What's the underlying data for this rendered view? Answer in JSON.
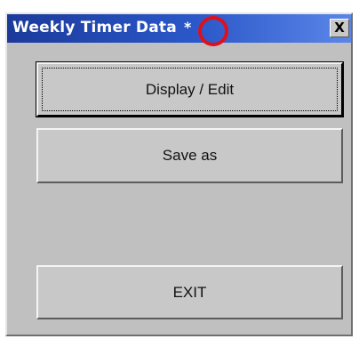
{
  "window": {
    "title": "Weekly Timer Data",
    "title_mark": "*",
    "close_label": "X"
  },
  "buttons": {
    "display_edit": "Display / Edit",
    "save_as": "Save as",
    "exit": "EXIT"
  },
  "colors": {
    "titlebar_start": "#1b3a9b",
    "titlebar_end": "#5b86e8",
    "window_face": "#c0c0c0",
    "highlight": "#e0101a"
  },
  "icons": {
    "close": "close-icon"
  }
}
